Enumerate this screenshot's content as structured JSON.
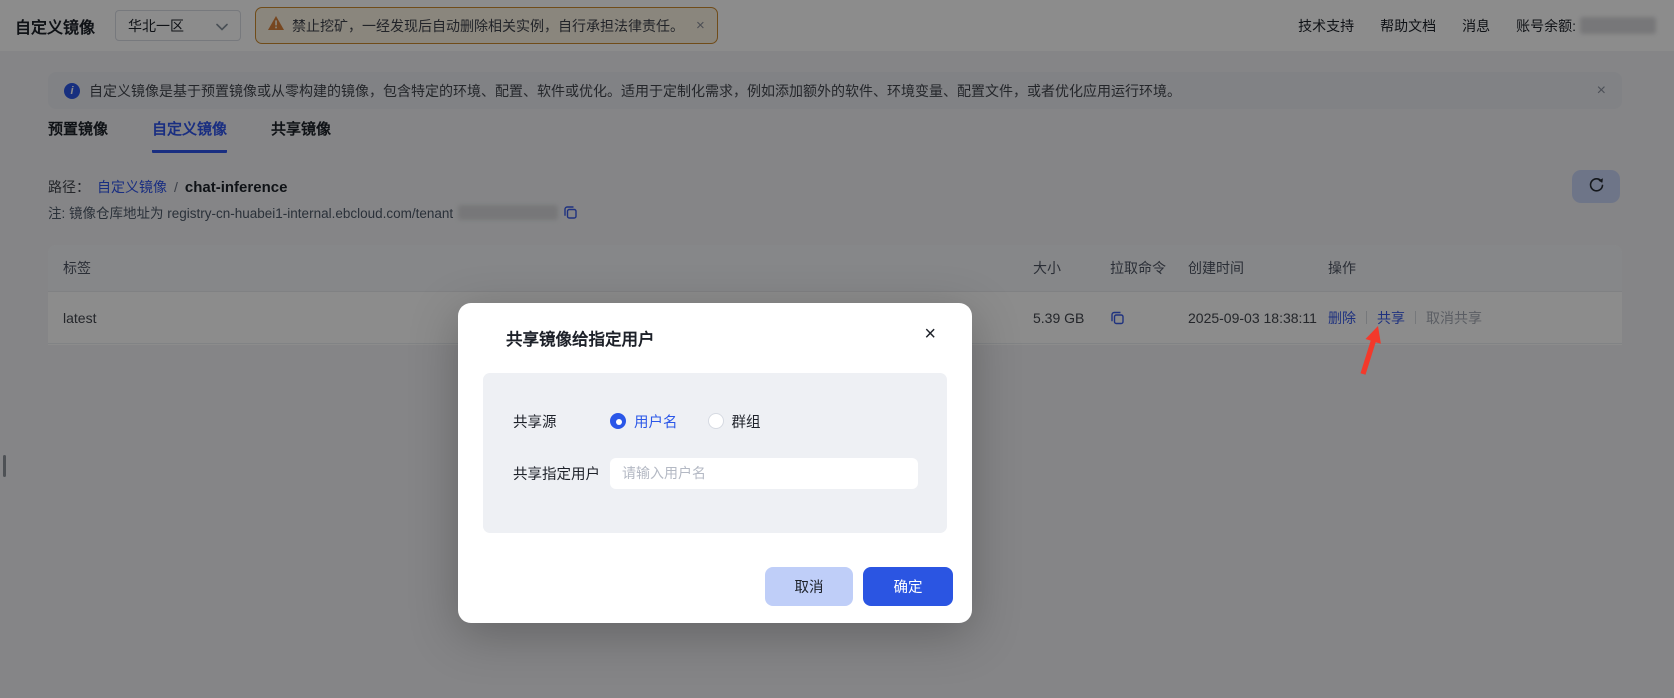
{
  "app": {
    "title": "自定义镜像",
    "region": "华北一区",
    "warning_text": "禁止挖矿，一经发现后自动删除相关实例，自行承担法律责任。",
    "nav_links": [
      {
        "label": "技术支持"
      },
      {
        "label": "帮助文档"
      },
      {
        "label": "消息"
      }
    ],
    "balance_label": "账号余额:"
  },
  "notice": {
    "text": "自定义镜像是基于预置镜像或从零构建的镜像，包含特定的环境、配置、软件或优化。适用于定制化需求，例如添加额外的软件、环境变量、配置文件，或者优化应用运行环境。"
  },
  "tabs": [
    {
      "label": "预置镜像"
    },
    {
      "label": "自定义镜像"
    },
    {
      "label": "共享镜像"
    }
  ],
  "breadcrumb": {
    "label": "路径：",
    "link": "自定义镜像",
    "separator": "/",
    "current": "chat-inference"
  },
  "registry_note": {
    "text": "注: 镜像仓库地址为 registry-cn-huabei1-internal.ebcloud.com/tenant"
  },
  "table": {
    "columns": [
      {
        "label": "标签"
      },
      {
        "label": "大小"
      },
      {
        "label": "拉取命令"
      },
      {
        "label": "创建时间"
      },
      {
        "label": "操作"
      }
    ],
    "row": {
      "tag": "latest",
      "size": "5.39 GB",
      "created": "2025-09-03 18:38:11",
      "action_delete": "删除",
      "action_share": "共享",
      "action_unshare": "取消共享"
    }
  },
  "modal": {
    "title": "共享镜像给指定用户",
    "source_label": "共享源",
    "radio_username": "用户名",
    "radio_group": "群组",
    "target_label": "共享指定用户",
    "input_placeholder": "请输入用户名",
    "cancel": "取消",
    "confirm": "确定"
  },
  "icons": {
    "close_glyph": "×",
    "info_glyph": "i"
  },
  "colors": {
    "primary": "#2b57e8",
    "link": "#3a5ce8",
    "warning_border": "#cd8a2e",
    "arrow": "#f3392b"
  }
}
